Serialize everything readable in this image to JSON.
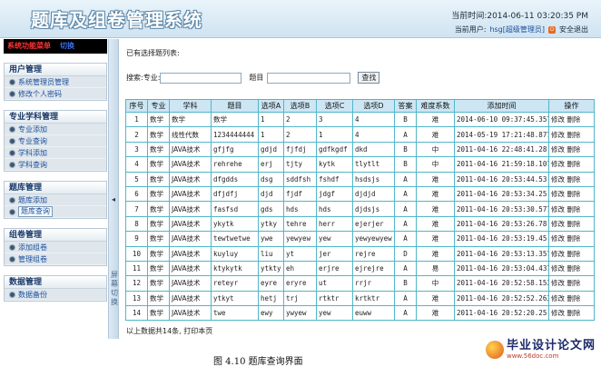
{
  "header": {
    "title": "题库及组卷管理系统",
    "time_label": "当前时间:",
    "time_value": "2014-06-11 03:20:35 PM",
    "user_label": "当前用户:",
    "user_name": "hsg[超级管理员]",
    "logout_label": "安全退出"
  },
  "sidebar": {
    "menu_title": "系统功能菜单",
    "menu_switch": "切换",
    "groups": [
      {
        "title": "用户管理",
        "items": [
          "系统管理员管理",
          "修改个人密码"
        ]
      },
      {
        "title": "专业学科管理",
        "items": [
          "专业添加",
          "专业查询",
          "学科添加",
          "学科查询"
        ]
      },
      {
        "title": "题库管理",
        "items": [
          "题库添加",
          "题库查询"
        ]
      },
      {
        "title": "组卷管理",
        "items": [
          "添加组卷",
          "管理组卷"
        ]
      },
      {
        "title": "数据管理",
        "items": [
          "数据备份"
        ]
      }
    ],
    "toggle_text": "屏幕切换"
  },
  "main": {
    "selected_label": "已有选择题列表:",
    "search": {
      "label1": "搜索:专业:",
      "value1": "",
      "label2": "题目",
      "value2": "",
      "button": "查找"
    },
    "columns": [
      "序号",
      "专业",
      "学科",
      "题目",
      "选项A",
      "选项B",
      "选项C",
      "选项D",
      "答案",
      "难度系数",
      "添加时间",
      "操作"
    ],
    "rows": [
      [
        "1",
        "数学",
        "数学",
        "数学",
        "1",
        "2",
        "3",
        "4",
        "B",
        "难",
        "2014-06-10 09:37:45.357",
        "修改",
        "删除"
      ],
      [
        "2",
        "数学",
        "线性代数",
        "1234444444",
        "1",
        "2",
        "1",
        "4",
        "A",
        "难",
        "2014-05-19 17:21:48.877",
        "修改",
        "删除"
      ],
      [
        "3",
        "数学",
        "JAVA技术",
        "gfjfg",
        "gdjd",
        "fjfdj",
        "gdfkgdf",
        "dkd",
        "B",
        "中",
        "2011-04-16 22:48:41.28",
        "修改",
        "删除"
      ],
      [
        "4",
        "数学",
        "JAVA技术",
        "rehrehe",
        "erj",
        "tjty",
        "kytk",
        "tlytlt",
        "B",
        "中",
        "2011-04-16 21:59:18.107",
        "修改",
        "删除"
      ],
      [
        "5",
        "数学",
        "JAVA技术",
        "dfgdds",
        "dsg",
        "sddfsh",
        "fshdf",
        "hsdsjs",
        "A",
        "难",
        "2011-04-16 20:53:44.53",
        "修改",
        "删除"
      ],
      [
        "6",
        "数学",
        "JAVA技术",
        "dfjdfj",
        "djd",
        "fjdf",
        "jdgf",
        "djdjd",
        "A",
        "难",
        "2011-04-16 20:53:34.25",
        "修改",
        "删除"
      ],
      [
        "7",
        "数学",
        "JAVA技术",
        "fasfsd",
        "gds",
        "hds",
        "hds",
        "djdsjs",
        "A",
        "难",
        "2011-04-16 20:53:30.577",
        "修改",
        "删除"
      ],
      [
        "8",
        "数学",
        "JAVA技术",
        "ykytk",
        "ytky",
        "tehre",
        "herr",
        "ejerjer",
        "A",
        "难",
        "2011-04-16 20:53:26.78",
        "修改",
        "删除"
      ],
      [
        "9",
        "数学",
        "JAVA技术",
        "tewtwetwe",
        "ywe",
        "yewyew",
        "yew",
        "yewyewyew",
        "A",
        "难",
        "2011-04-16 20:53:19.45",
        "修改",
        "删除"
      ],
      [
        "10",
        "数学",
        "JAVA技术",
        "kuyluy",
        "liu",
        "yt",
        "jer",
        "rejre",
        "D",
        "难",
        "2011-04-16 20:53:13.357",
        "修改",
        "删除"
      ],
      [
        "11",
        "数学",
        "JAVA技术",
        "ktykytk",
        "ytkty",
        "eh",
        "erjre",
        "ejrejre",
        "A",
        "易",
        "2011-04-16 20:53:04.437",
        "修改",
        "删除"
      ],
      [
        "12",
        "数学",
        "JAVA技术",
        "reteyr",
        "eyre",
        "eryre",
        "ut",
        "rrjr",
        "B",
        "中",
        "2011-04-16 20:52:58.153",
        "修改",
        "删除"
      ],
      [
        "13",
        "数学",
        "JAVA技术",
        "ytkyt",
        "hetj",
        "trj",
        "rtktr",
        "krtktr",
        "A",
        "难",
        "2011-04-16 20:52:52.263",
        "修改",
        "删除"
      ],
      [
        "14",
        "数学",
        "JAVA技术",
        "twe",
        "ewy",
        "ywyew",
        "yew",
        "euww",
        "A",
        "难",
        "2011-04-16 20:52:20.25",
        "修改",
        "删除"
      ]
    ],
    "footer_note": "以上数据共14条, 打印本页"
  },
  "caption": "图 4.10 题库查询界面",
  "watermark": {
    "big": "毕业设计论文网",
    "small": "www.56doc.com"
  }
}
